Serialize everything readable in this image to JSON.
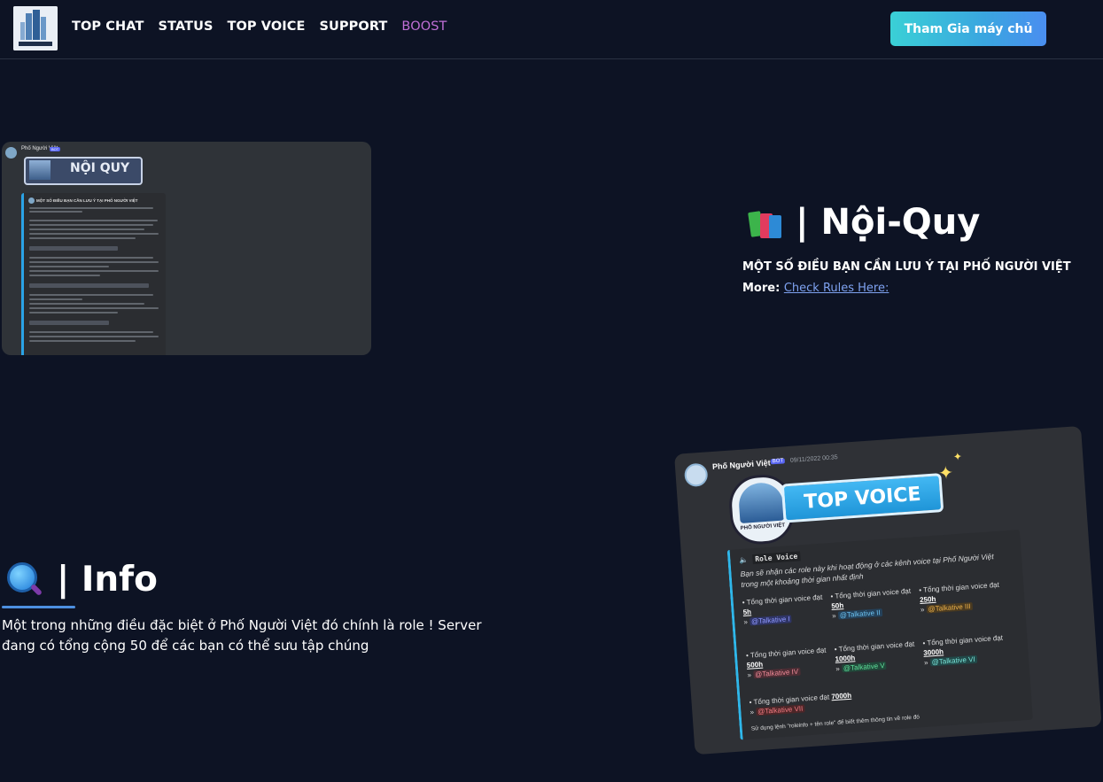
{
  "nav": {
    "links": [
      {
        "label": "TOP CHAT"
      },
      {
        "label": "STATUS"
      },
      {
        "label": "TOP VOICE"
      },
      {
        "label": "SUPPORT"
      },
      {
        "label": "BOOST"
      }
    ],
    "join_button": "Tham Gia máy chủ",
    "logo_text": "PHỐ NGƯỜI VIỆT"
  },
  "rules": {
    "title": "| Nội-Quy",
    "description": "MỘT SỐ ĐIỀU BẠN CẦN LƯU Ý TẠI PHỐ NGƯỜI VIỆT",
    "more_label": "More:",
    "more_link": "Check Rules Here:",
    "screenshot": {
      "bot_name": "Phố Người Việt",
      "bot_tag": "BOT",
      "banner_text": "NỘI QUY",
      "embed_title": "MỘT SỐ ĐIỀU BẠN CẦN LƯU Ý TẠI PHỐ NGƯỜI VIỆT"
    }
  },
  "info": {
    "title": "| Info",
    "description": "Một trong những điều đặc biệt ở Phố Người Việt đó chính là role ! Server đang có tổng cộng 50 để các bạn có thể sưu tập chúng"
  },
  "voice_screenshot": {
    "bot_name": "Phố Người Việt",
    "bot_tag": "BOT",
    "timestamp": "09/11/2022 00:35",
    "logo_caption": "PHỐ NGƯỜI VIỆT",
    "banner": "TOP VOICE",
    "header": "Role Voice",
    "subtitle": "Bạn sẽ nhận các role này khi hoạt động ở các kênh voice tại Phố Người Việt trong một khoảng thời gian nhất định",
    "label": "• Tổng thời gian voice đạt",
    "items": [
      {
        "hours": "5h",
        "role": "@Talkative I",
        "color": "#5865f2"
      },
      {
        "hours": "50h",
        "role": "@Talkative II",
        "color": "#3aa3e6"
      },
      {
        "hours": "250h",
        "role": "@Talkative III",
        "color": "#e3a727"
      },
      {
        "hours": "500h",
        "role": "@Talkative IV",
        "color": "#e36a7a"
      },
      {
        "hours": "1000h",
        "role": "@Talkative V",
        "color": "#3cc47a"
      },
      {
        "hours": "3000h",
        "role": "@Talkative VI",
        "color": "#56d6c8"
      },
      {
        "hours": "7000h",
        "role": "@Talkative VII",
        "color": "#e0505a"
      }
    ],
    "note": "Sử dụng lệnh \"roleinfo + tên role\" để biết thêm thông tin về role đó"
  },
  "colors": {
    "background": "#0d1324",
    "accent_gradient_start": "#3ad0d6",
    "accent_gradient_end": "#4a8ef0",
    "boost": "#c06fd6",
    "link": "#7ea2f0"
  },
  "icons": {
    "rules": "books-icon",
    "info": "magnifier-icon"
  }
}
